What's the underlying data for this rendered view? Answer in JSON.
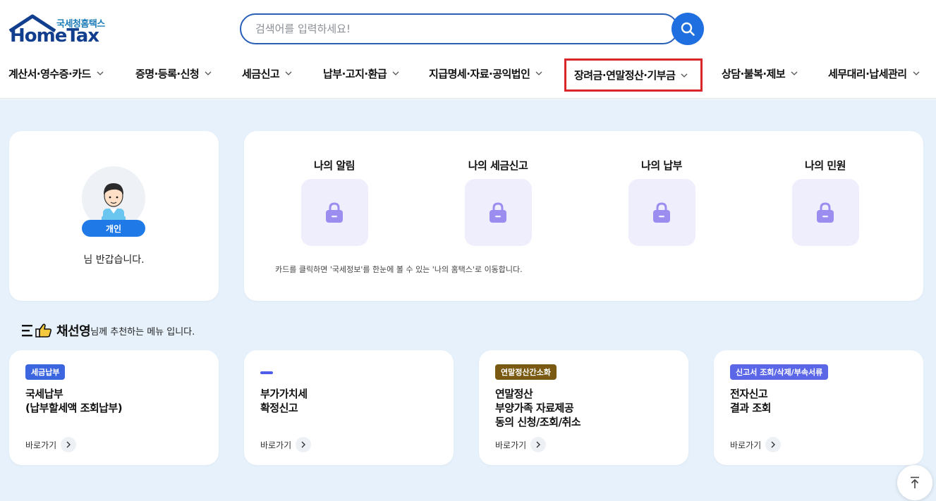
{
  "header": {
    "logo_sub": "국세청홈택스",
    "logo_main": "HomeTax",
    "search_placeholder": "검색어를 입력하세요!"
  },
  "nav": [
    {
      "label": "계산서·영수증·카드",
      "highlighted": false
    },
    {
      "label": "증명·등록·신청",
      "highlighted": false
    },
    {
      "label": "세금신고",
      "highlighted": false
    },
    {
      "label": "납부·고지·환급",
      "highlighted": false
    },
    {
      "label": "지급명세·자료·공익법인",
      "highlighted": false
    },
    {
      "label": "장려금·연말정산·기부금",
      "highlighted": true
    },
    {
      "label": "상담·불복·제보",
      "highlighted": false
    },
    {
      "label": "세무대리·납세관리",
      "highlighted": false
    }
  ],
  "profile": {
    "type_label": "개인",
    "greeting": "님 반갑습니다."
  },
  "mine": {
    "items": [
      {
        "title": "나의 알림"
      },
      {
        "title": "나의 세금신고"
      },
      {
        "title": "나의 납부"
      },
      {
        "title": "나의 민원"
      }
    ],
    "note": "카드를 클릭하면 '국세정보'를 한눈에 볼 수 있는 '나의 홈택스'로 이동합니다."
  },
  "recommend": {
    "user_name": "채선영",
    "suffix": "님께 추천하는 메뉴 입니다.",
    "cards": [
      {
        "tag": "세금납부",
        "tag_color": "#3b66e0",
        "text": "국세납부\n(납부할세액 조회납부)",
        "link": "바로가기"
      },
      {
        "tag": "",
        "tag_color": "",
        "text": "부가가치세\n확정신고",
        "link": "바로가기"
      },
      {
        "tag": "연말정산간소화",
        "tag_color": "#7a5a12",
        "text": "연말정산\n부양가족 자료제공\n동의 신청/조회/취소",
        "link": "바로가기"
      },
      {
        "tag": "신고서 조회/삭제/부속서류",
        "tag_color": "#5b67e6",
        "text": "전자신고\n결과 조회",
        "link": "바로가기"
      }
    ]
  },
  "colors": {
    "brand_blue": "#1f6fe0",
    "page_bg": "#e6f1fb",
    "highlight_red": "#d9262a",
    "lock_purple": "#9b8df0"
  }
}
